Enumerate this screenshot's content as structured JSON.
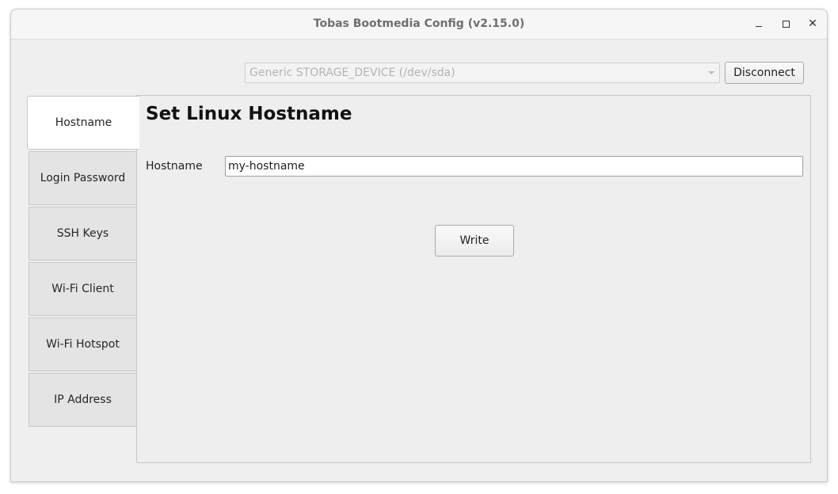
{
  "window": {
    "title": "Tobas Bootmedia Config (v2.15.0)",
    "controls": {
      "minimize": "minimize-icon",
      "maximize": "maximize-icon",
      "close": "close-icon",
      "close_glyph": "✕"
    }
  },
  "device": {
    "selected": "Generic STORAGE_DEVICE (/dev/sda)",
    "disconnect_label": "Disconnect"
  },
  "tabs": [
    {
      "label": "Hostname",
      "active": true
    },
    {
      "label": "Login Password",
      "active": false
    },
    {
      "label": "SSH Keys",
      "active": false
    },
    {
      "label": "Wi-Fi Client",
      "active": false
    },
    {
      "label": "Wi-Fi Hotspot",
      "active": false
    },
    {
      "label": "IP Address",
      "active": false
    }
  ],
  "hostname_page": {
    "title": "Set Linux Hostname",
    "field_label": "Hostname",
    "field_value": "my-hostname",
    "write_label": "Write"
  }
}
